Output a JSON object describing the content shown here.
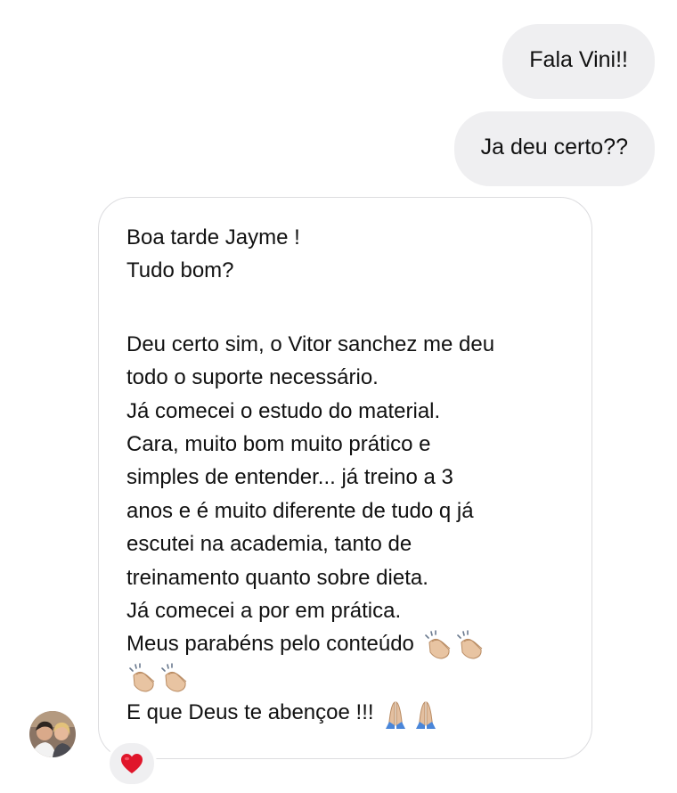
{
  "messages": {
    "sent": [
      {
        "text": "Fala Vini!!"
      },
      {
        "text": "Ja deu certo??"
      }
    ],
    "received": {
      "lines": [
        "Boa tarde Jayme !",
        "Tudo bom?",
        "",
        "Deu certo sim, o Vitor sanchez me deu",
        "todo o suporte necessário.",
        "Já comecei o estudo do material.",
        "Cara, muito bom muito prático e",
        "simples de entender... já treino a 3",
        "anos e é muito diferente de tudo q já",
        "escutei na academia, tanto de",
        "treinamento quanto sobre dieta.",
        "Já comecei a por em prática.",
        "Meus parabéns pelo conteúdo",
        "",
        "E que Deus te abençoe !!!"
      ],
      "clap_emoji": "clapping-hands-icon",
      "pray_emoji": "folded-hands-icon"
    },
    "reaction": "heart-icon"
  },
  "colors": {
    "sent_bubble": "#efeff1",
    "received_border": "#dcdcdf",
    "heart": "#e0162b"
  }
}
